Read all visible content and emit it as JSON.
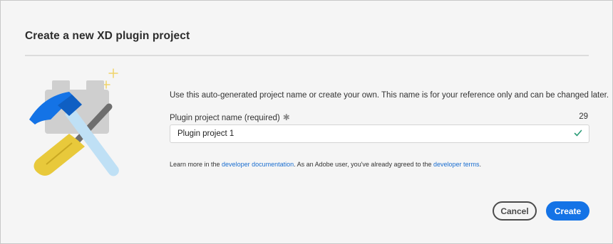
{
  "dialog": {
    "title": "Create a new XD plugin project",
    "intro": "Use this auto-generated project name or create your own. This name is for your reference only and can be changed later.",
    "field": {
      "label": "Plugin project name (required)",
      "required_mark": "✱",
      "char_count": "29",
      "value": "Plugin project 1",
      "valid_icon": "check-icon"
    },
    "learn_more": {
      "prefix": "Learn more in the ",
      "doc_link": "developer documentation",
      "middle": ". As an Adobe user, you've already agreed to the ",
      "terms_link": "developer terms",
      "suffix": "."
    },
    "buttons": {
      "cancel": "Cancel",
      "create": "Create"
    },
    "illustration": "hammer-and-screwdriver-icon",
    "colors": {
      "accent": "#1473e6",
      "link": "#1a6ed0",
      "valid": "#2d9d78"
    }
  }
}
